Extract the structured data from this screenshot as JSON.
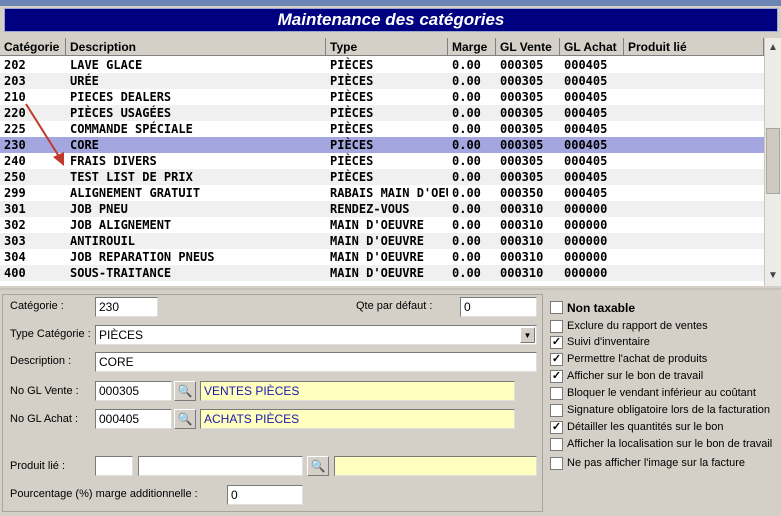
{
  "title": "Maintenance des catégories",
  "grid": {
    "columns": [
      "Catégorie",
      "Description",
      "Type",
      "Marge",
      "GL Vente",
      "GL Achat",
      "Produit lié"
    ],
    "rows": [
      [
        "202",
        "LAVE GLACE",
        "PIÈCES",
        "0.00",
        "000305",
        "000405",
        ""
      ],
      [
        "203",
        "URÉE",
        "PIÈCES",
        "0.00",
        "000305",
        "000405",
        ""
      ],
      [
        "210",
        "PIECES DEALERS",
        "PIÈCES",
        "0.00",
        "000305",
        "000405",
        ""
      ],
      [
        "220",
        "PIÈCES USAGÉES",
        "PIÈCES",
        "0.00",
        "000305",
        "000405",
        ""
      ],
      [
        "225",
        "COMMANDE SPÉCIALE",
        "PIÈCES",
        "0.00",
        "000305",
        "000405",
        ""
      ],
      [
        "230",
        "CORE",
        "PIÈCES",
        "0.00",
        "000305",
        "000405",
        ""
      ],
      [
        "240",
        "FRAIS DIVERS",
        "PIÈCES",
        "0.00",
        "000305",
        "000405",
        ""
      ],
      [
        "250",
        "TEST LIST DE PRIX",
        "PIÈCES",
        "0.00",
        "000305",
        "000405",
        ""
      ],
      [
        "299",
        "ALIGNEMENT GRATUIT",
        "RABAIS MAIN D'OEU",
        "0.00",
        "000350",
        "000405",
        ""
      ],
      [
        "301",
        "JOB PNEU",
        "RENDEZ-VOUS",
        "0.00",
        "000310",
        "000000",
        ""
      ],
      [
        "302",
        "JOB ALIGNEMENT",
        "MAIN D'OEUVRE",
        "0.00",
        "000310",
        "000000",
        ""
      ],
      [
        "303",
        "ANTIROUIL",
        "MAIN D'OEUVRE",
        "0.00",
        "000310",
        "000000",
        ""
      ],
      [
        "304",
        "JOB REPARATION PNEUS",
        "MAIN D'OEUVRE",
        "0.00",
        "000310",
        "000000",
        ""
      ],
      [
        "400",
        "SOUS-TRAITANCE",
        "MAIN D'OEUVRE",
        "0.00",
        "000310",
        "000000",
        ""
      ]
    ],
    "selected_index": 5
  },
  "form": {
    "categorie_label": "Catégorie :",
    "categorie_value": "230",
    "qte_label": "Qte par défaut :",
    "qte_value": "0",
    "type_label": "Type Catégorie :",
    "type_value": "PIÈCES",
    "description_label": "Description :",
    "description_value": "CORE",
    "gl_vente_label": "No GL Vente :",
    "gl_vente_value": "000305",
    "gl_vente_desc": "VENTES PIÈCES",
    "gl_achat_label": "No GL Achat :",
    "gl_achat_value": "000405",
    "gl_achat_desc": "ACHATS PIÈCES",
    "produit_label": "Produit lié :",
    "produit_code": "",
    "produit_name": "",
    "produit_desc": "",
    "pourcentage_label": "Pourcentage (%) marge additionnelle :",
    "pourcentage_value": "0"
  },
  "options": [
    {
      "label": "Non taxable",
      "checked": false,
      "bold": true
    },
    {
      "label": "Exclure du rapport de ventes",
      "checked": false
    },
    {
      "label": "Suivi d'inventaire",
      "checked": true
    },
    {
      "label": "Permettre l'achat de produits",
      "checked": true
    },
    {
      "label": "Afficher sur le bon de travail",
      "checked": true
    },
    {
      "label": "Bloquer le vendant inférieur au coûtant",
      "checked": false
    },
    {
      "label": "Signature obligatoire lors de la facturation",
      "checked": false
    },
    {
      "label": "Détailler les quantités sur le bon",
      "checked": true
    },
    {
      "label": "Afficher la localisation sur le bon de travail",
      "checked": false
    },
    {
      "label": "Ne pas afficher l'image sur la facture",
      "checked": false
    }
  ],
  "icons": {
    "search": "search-icon",
    "dropdown": "chevron-down-icon",
    "scroll_up": "scroll-up-icon",
    "scroll_down": "scroll-down-icon"
  },
  "colors": {
    "title_bg": "#000080",
    "selected_row": "#a4a6e0",
    "highlight_field": "#ffffc0",
    "annotation_arrow": "#c0392b"
  }
}
